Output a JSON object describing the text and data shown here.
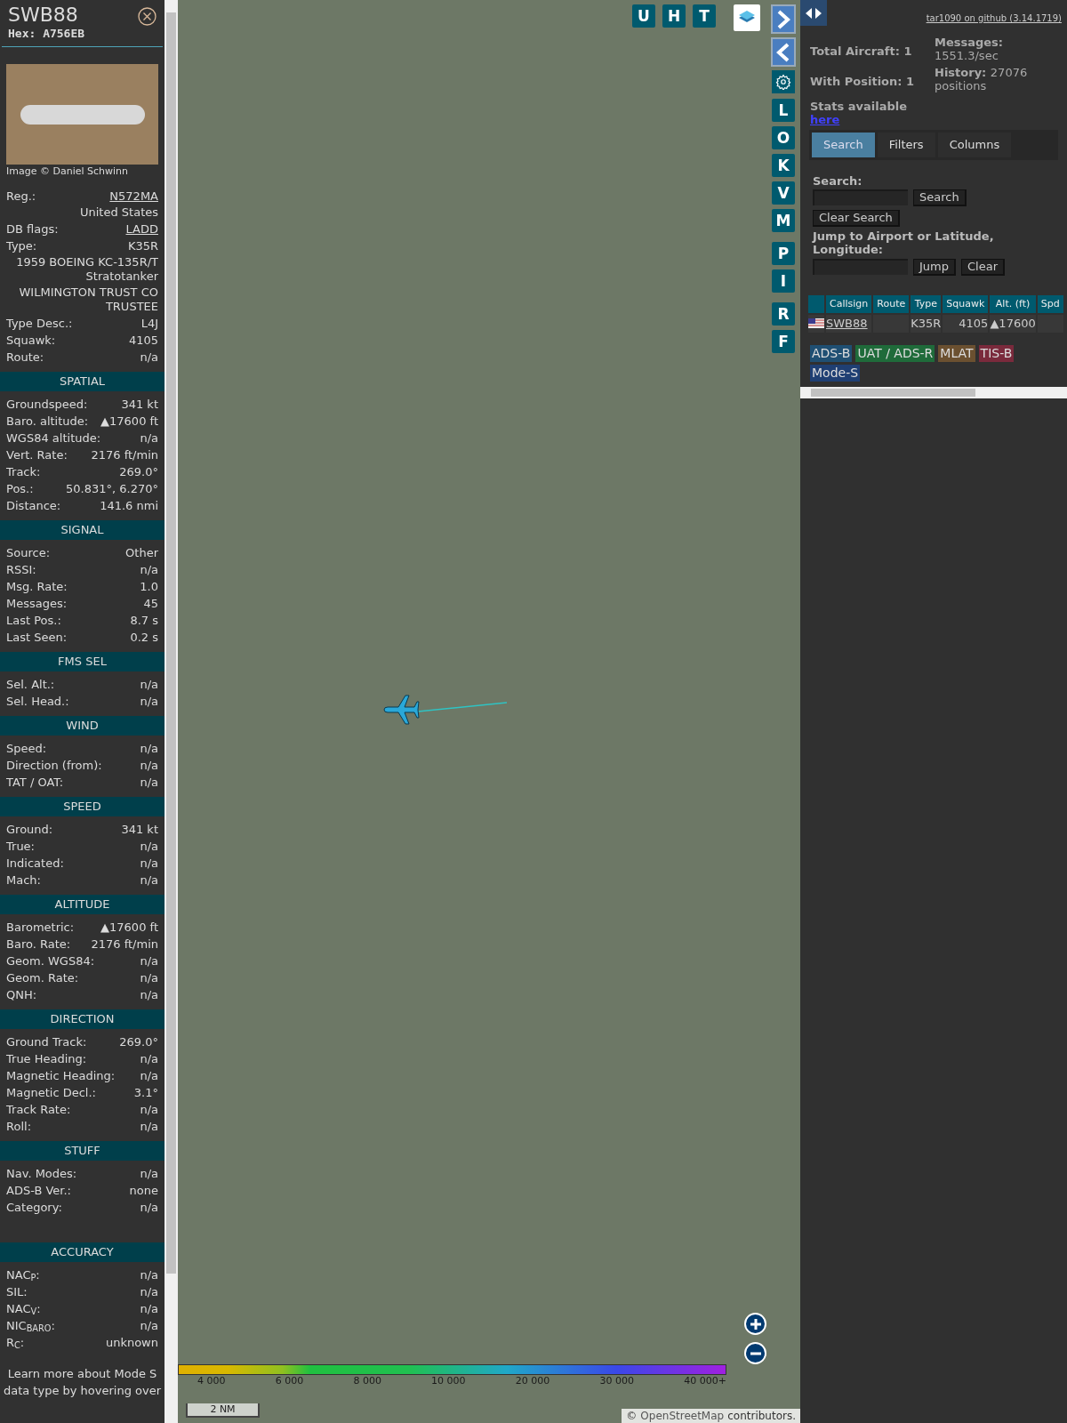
{
  "detail": {
    "callsign": "SWB88",
    "hex": "Hex: A756EB",
    "photo_credit": "Image © Daniel Schwinn",
    "rows": [
      {
        "label": "Reg.:",
        "value": "N572MA",
        "kind": "link"
      },
      {
        "value": "United States",
        "kind": "plain"
      },
      {
        "label": "DB flags:",
        "value": "LADD",
        "kind": "link"
      },
      {
        "label": "Type:",
        "value": "K35R",
        "kind": "plain"
      },
      {
        "value": "1959 BOEING KC-135R/T Stratotanker",
        "kind": "plain"
      },
      {
        "value": "WILMINGTON TRUST CO TRUSTEE",
        "kind": "plain"
      },
      {
        "label": "Type Desc.:",
        "value": "L4J",
        "kind": "plain"
      },
      {
        "label": "Squawk:",
        "value": "4105",
        "kind": "plain"
      },
      {
        "label": "Route:",
        "value": "n/a",
        "kind": "plain"
      }
    ],
    "sections": [
      {
        "title": "SPATIAL",
        "rows": [
          {
            "label": "Groundspeed:",
            "value": "341 kt"
          },
          {
            "label": "Baro. altitude:",
            "value": "▲17600 ft"
          },
          {
            "label": "WGS84 altitude:",
            "value": "n/a"
          },
          {
            "label": "Vert. Rate:",
            "value": "2176 ft/min"
          },
          {
            "label": "Track:",
            "value": "269.0°"
          },
          {
            "label": "Pos.:",
            "value": "50.831°, 6.270°"
          },
          {
            "label": "Distance:",
            "value": "141.6 nmi"
          }
        ]
      },
      {
        "title": "SIGNAL",
        "rows": [
          {
            "label": "Source:",
            "value": "Other"
          },
          {
            "label": "RSSI:",
            "value": "n/a"
          },
          {
            "label": "Msg. Rate:",
            "value": "1.0"
          },
          {
            "label": "Messages:",
            "value": "45"
          },
          {
            "label": "Last Pos.:",
            "value": "8.7 s"
          },
          {
            "label": "Last Seen:",
            "value": "0.2 s"
          }
        ]
      },
      {
        "title": "FMS SEL",
        "rows": [
          {
            "label": "Sel. Alt.:",
            "value": "n/a"
          },
          {
            "label": "Sel. Head.:",
            "value": "n/a"
          }
        ]
      },
      {
        "title": "WIND",
        "rows": [
          {
            "label": "Speed:",
            "value": "n/a"
          },
          {
            "label": "Direction (from):",
            "value": "n/a"
          },
          {
            "label": "TAT / OAT:",
            "value": "n/a"
          }
        ]
      },
      {
        "title": "SPEED",
        "rows": [
          {
            "label": "Ground:",
            "value": "341 kt"
          },
          {
            "label": "True:",
            "value": "n/a"
          },
          {
            "label": "Indicated:",
            "value": "n/a"
          },
          {
            "label": "Mach:",
            "value": "n/a"
          }
        ]
      },
      {
        "title": "ALTITUDE",
        "rows": [
          {
            "label": "Barometric:",
            "value": "▲17600 ft"
          },
          {
            "label": "Baro. Rate:",
            "value": "2176 ft/min"
          },
          {
            "label": "Geom. WGS84:",
            "value": "n/a"
          },
          {
            "label": "Geom. Rate:",
            "value": "n/a"
          },
          {
            "label": "QNH:",
            "value": "n/a"
          }
        ]
      },
      {
        "title": "DIRECTION",
        "rows": [
          {
            "label": "Ground Track:",
            "value": "269.0°"
          },
          {
            "label": "True Heading:",
            "value": "n/a"
          },
          {
            "label": "Magnetic Heading:",
            "value": "n/a"
          },
          {
            "label": "Magnetic Decl.:",
            "value": "3.1°"
          },
          {
            "label": "Track Rate:",
            "value": "n/a"
          },
          {
            "label": "Roll:",
            "value": "n/a"
          }
        ]
      },
      {
        "title": "STUFF",
        "rows": [
          {
            "label": "Nav. Modes:",
            "value": "n/a"
          },
          {
            "label": "ADS-B Ver.:",
            "value": "none"
          },
          {
            "label": "Category:",
            "value": "n/a"
          }
        ]
      },
      {
        "title": "ACCURACY",
        "rows": [
          {
            "label": "NAC$_{P}$:",
            "value": "n/a"
          },
          {
            "label": "SIL:",
            "value": "n/a"
          },
          {
            "label": "NAC$_{V}$:",
            "value": "n/a"
          },
          {
            "label": "NIC$_{BARO}$:",
            "value": "n/a"
          },
          {
            "label": "R$_{C}$:",
            "value": "unknown"
          }
        ]
      }
    ],
    "footer": "Learn more about Mode S data type by hovering over"
  },
  "map": {
    "top_buttons": [
      "U",
      "H",
      "T"
    ],
    "side_buttons": [
      "L",
      "O",
      "K",
      "V",
      "M",
      "P",
      "I",
      "R",
      "F"
    ],
    "legend_ticks": [
      "4 000",
      "6 000",
      "8 000",
      "10 000",
      "20 000",
      "30 000",
      "40 000+"
    ],
    "scale": "2 NM",
    "attribution_link": "OpenStreetMap",
    "attribution_prefix": "©",
    "attribution_suffix": "contributors."
  },
  "panel": {
    "github_link": "tar1090 on github (3.14.1719)",
    "stats": [
      {
        "label": "Total Aircraft:",
        "value": "1"
      },
      {
        "label": "With Position:",
        "value": "1"
      },
      {
        "label": "Messages:",
        "value": "1551.3/sec"
      },
      {
        "label": "History:",
        "value": "27076 positions"
      }
    ],
    "stats_note": "Stats available",
    "stats_link": "here",
    "tabs": [
      {
        "label": "Search",
        "selected": true
      },
      {
        "label": "Filters",
        "selected": false
      },
      {
        "label": "Columns",
        "selected": false
      }
    ],
    "search_label": "Search:",
    "search_button": "Search",
    "clear_search_button": "Clear Search",
    "jump_label": "Jump to Airport or Latitude, Longitude:",
    "jump_button": "Jump",
    "clear_button": "Clear",
    "table": {
      "columns": [
        "Callsign",
        "Route",
        "Type",
        "Squawk",
        "Alt. (ft)",
        "Spd"
      ],
      "rows": [
        {
          "callsign": "SWB88",
          "type": "K35R",
          "squawk": "4105",
          "altitude": "▲17600"
        }
      ]
    },
    "sources": [
      {
        "label": "ADS-B",
        "color": "#1f4f73"
      },
      {
        "label": "UAT / ADS-R",
        "color": "#1f6b3a"
      },
      {
        "label": "MLAT",
        "color": "#6b5030"
      },
      {
        "label": "TIS-B",
        "color": "#7a2a3c"
      },
      {
        "label": "Mode-S",
        "color": "#1f3f73"
      }
    ]
  }
}
